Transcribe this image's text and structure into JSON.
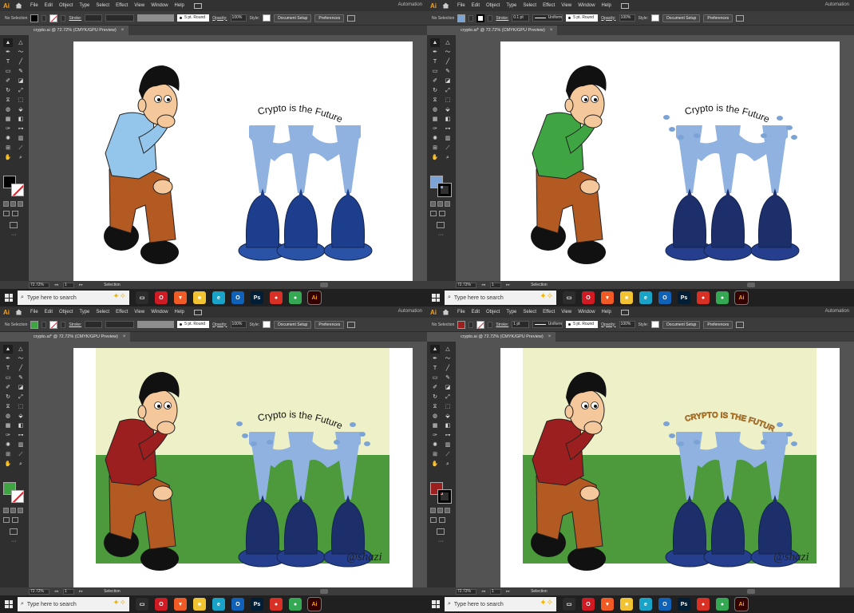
{
  "panels": [
    {
      "menu": [
        "File",
        "Edit",
        "Object",
        "Type",
        "Select",
        "Effect",
        "View",
        "Window",
        "Help"
      ],
      "mode": "Automation",
      "selection_label": "No Selection",
      "fill_color": "#000000",
      "stroke_mode": "none",
      "stroke_label": "Stroke:",
      "stroke_value": "",
      "show_grey_profile": true,
      "brush": "5 pt. Round",
      "opacity_label": "Opacity:",
      "opacity": "100%",
      "style_label": "Style:",
      "doc_setup": "Document Setup",
      "preferences": "Preferences",
      "tab_title": "crypto.ai @ 72.72% (CMYK/GPU Preview)",
      "tab_close": "×",
      "tool_fill": "#000000",
      "tool_stroke": "none",
      "zoom": "72.72%",
      "artboard_num": "1",
      "status_tool": "Selection",
      "taskbar_search": "Type here to search",
      "art": {
        "background": "white",
        "shirt_color": "#93c6ea",
        "pants_color": "#b35a22",
        "shoe_color": "#111111",
        "bulb_color": "#1d3e8c",
        "bulb_base_color": "#2a53a8",
        "beam_color": "#8fb2e0",
        "caption": "Crypto is the Future",
        "caption_style": "plain",
        "droplets": false,
        "signature": ""
      }
    },
    {
      "menu": [
        "File",
        "Edit",
        "Object",
        "Type",
        "Select",
        "Effect",
        "View",
        "Window",
        "Help"
      ],
      "mode": "Automation",
      "selection_label": "No Selection",
      "fill_color": "#7ba3d6",
      "stroke_mode": "black",
      "stroke_label": "Stroke:",
      "stroke_value": "0.1 pt",
      "show_grey_profile": false,
      "profile": "Uniform",
      "brush": "5 pt. Round",
      "opacity_label": "Opacity:",
      "opacity": "100%",
      "style_label": "Style:",
      "doc_setup": "Document Setup",
      "preferences": "Preferences",
      "tab_title": "crypto.ai* @ 72.72% (CMYK/GPU Preview)",
      "tab_close": "×",
      "tool_fill": "#7ba3d6",
      "tool_stroke": "black",
      "zoom": "72.72%",
      "artboard_num": "1",
      "status_tool": "Selection",
      "taskbar_search": "Type here to search",
      "art": {
        "background": "white",
        "shirt_color": "#3fa543",
        "pants_color": "#b35a22",
        "shoe_color": "#111111",
        "bulb_color": "#1c2f6b",
        "bulb_base_color": "#253f8e",
        "beam_color": "#8fb2e0",
        "caption": "Crypto is the Future",
        "caption_style": "plain",
        "droplets": true,
        "signature": ""
      }
    },
    {
      "menu": [
        "File",
        "Edit",
        "Object",
        "Type",
        "Select",
        "Effect",
        "View",
        "Window",
        "Help"
      ],
      "mode": "Automation",
      "selection_label": "No Selection",
      "fill_color": "#3fa543",
      "stroke_mode": "none",
      "stroke_label": "Stroke:",
      "stroke_value": "",
      "show_grey_profile": true,
      "brush": "5 pt. Round",
      "opacity_label": "Opacity:",
      "opacity": "100%",
      "style_label": "Style:",
      "doc_setup": "Document Setup",
      "preferences": "Preferences",
      "tab_title": "crypto.ai* @ 72.72% (CMYK/GPU Preview)",
      "tab_close": "×",
      "tool_fill": "#3fa543",
      "tool_stroke": "none",
      "zoom": "72.72%",
      "artboard_num": "1",
      "status_tool": "Selection",
      "taskbar_search": "Type here to search",
      "art": {
        "background": "scene",
        "shirt_color": "#9b1f1f",
        "pants_color": "#b35a22",
        "shoe_color": "#111111",
        "bulb_color": "#1c2f6b",
        "bulb_base_color": "#253f8e",
        "beam_color": "#8fb2e0",
        "caption": "Crypto is the Future",
        "caption_style": "plain",
        "droplets": true,
        "signature": "@shazi"
      }
    },
    {
      "menu": [
        "File",
        "Edit",
        "Object",
        "Type",
        "Select",
        "Effect",
        "View",
        "Window",
        "Help"
      ],
      "mode": "Automation",
      "selection_label": "No Selection",
      "fill_color": "#9b1f1f",
      "stroke_mode": "none",
      "stroke_label": "Stroke:",
      "stroke_value": "1 pt",
      "show_grey_profile": false,
      "profile": "Uniform",
      "brush": "5 pt. Round",
      "opacity_label": "Opacity:",
      "opacity": "100%",
      "style_label": "Style:",
      "doc_setup": "Document Setup",
      "preferences": "Preferences",
      "tab_title": "crypto.ai @ 72.72% (CMYK/GPU Preview)",
      "tab_close": "×",
      "tool_fill": "#9b1f1f",
      "tool_stroke": "black",
      "zoom": "72.72%",
      "artboard_num": "1",
      "status_tool": "Selection",
      "taskbar_search": "Type here to search",
      "art": {
        "background": "scene",
        "shirt_color": "#9b1f1f",
        "pants_color": "#b35a22",
        "shoe_color": "#111111",
        "bulb_color": "#1c2f6b",
        "bulb_base_color": "#253f8e",
        "beam_color": "#8fb2e0",
        "caption": "CRYPTO IS THE FUTURE",
        "caption_style": "bold",
        "droplets": true,
        "signature": "@shazi"
      }
    }
  ],
  "taskbar_apps": [
    {
      "icon": "task-view-icon",
      "color": "#2c2c2c",
      "glyph": "▭"
    },
    {
      "icon": "opera-icon",
      "color": "#d11b24",
      "glyph": "O"
    },
    {
      "icon": "brave-icon",
      "color": "#f05a24",
      "glyph": "▼"
    },
    {
      "icon": "file-explorer-icon",
      "color": "#f1c232",
      "glyph": "■"
    },
    {
      "icon": "edge-icon",
      "color": "#1aa3c8",
      "glyph": "e"
    },
    {
      "icon": "outlook-icon",
      "color": "#0f62b8",
      "glyph": "O"
    },
    {
      "icon": "photoshop-icon",
      "color": "#001e36",
      "glyph": "Ps"
    },
    {
      "icon": "chrome-red-icon",
      "color": "#d93025",
      "glyph": "●"
    },
    {
      "icon": "chrome-icon",
      "color": "#34a853",
      "glyph": "●"
    },
    {
      "icon": "illustrator-icon",
      "color": "#330000",
      "glyph": "Ai"
    }
  ],
  "colors": {
    "scene_sky": "#eef0c8",
    "scene_grass": "#4c9a3c",
    "skin": "#f4c89a",
    "hair": "#111111",
    "app_bg": "#535353"
  }
}
